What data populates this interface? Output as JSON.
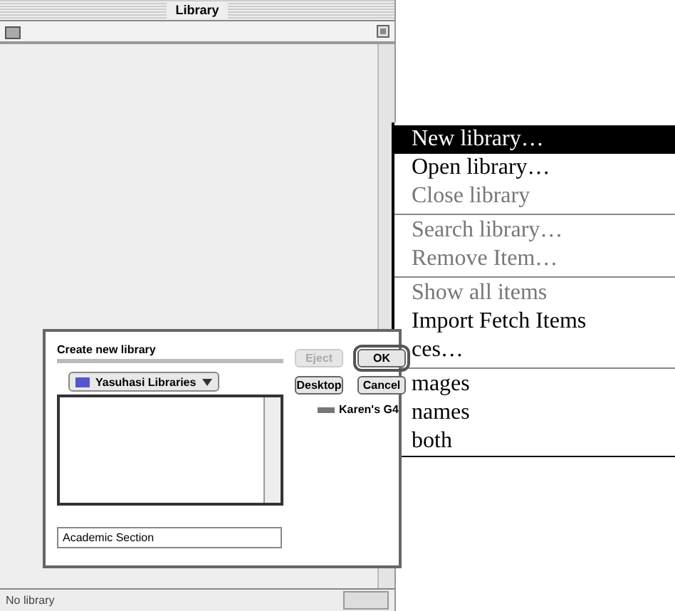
{
  "window": {
    "title": "Library",
    "status": "No library"
  },
  "menu": {
    "groups": [
      [
        {
          "label": "New library…",
          "selected": true,
          "disabled": false
        },
        {
          "label": "Open library…",
          "selected": false,
          "disabled": false
        },
        {
          "label": "Close library",
          "selected": false,
          "disabled": true
        }
      ],
      [
        {
          "label": "Search library…",
          "selected": false,
          "disabled": true
        },
        {
          "label": "Remove Item…",
          "selected": false,
          "disabled": true
        }
      ],
      [
        {
          "label": "Show all items",
          "selected": false,
          "disabled": true
        },
        {
          "label": "Import Fetch Items",
          "selected": false,
          "disabled": false
        },
        {
          "label": "ces…",
          "selected": false,
          "disabled": false
        }
      ],
      [
        {
          "label": "mages",
          "selected": false,
          "disabled": false
        },
        {
          "label": "names",
          "selected": false,
          "disabled": false
        },
        {
          "label": "both",
          "selected": false,
          "disabled": false
        }
      ]
    ]
  },
  "dialog": {
    "title": "Create new library",
    "folder": "Yasuhasi Libraries",
    "disk": "Karen's G4",
    "name_value": "Academic Section",
    "buttons": [
      {
        "label": "Eject",
        "disabled": true,
        "default": false
      },
      {
        "label": "OK",
        "disabled": false,
        "default": true
      },
      {
        "label": "Desktop",
        "disabled": false,
        "default": false
      },
      {
        "label": "Cancel",
        "disabled": false,
        "default": false
      }
    ]
  }
}
